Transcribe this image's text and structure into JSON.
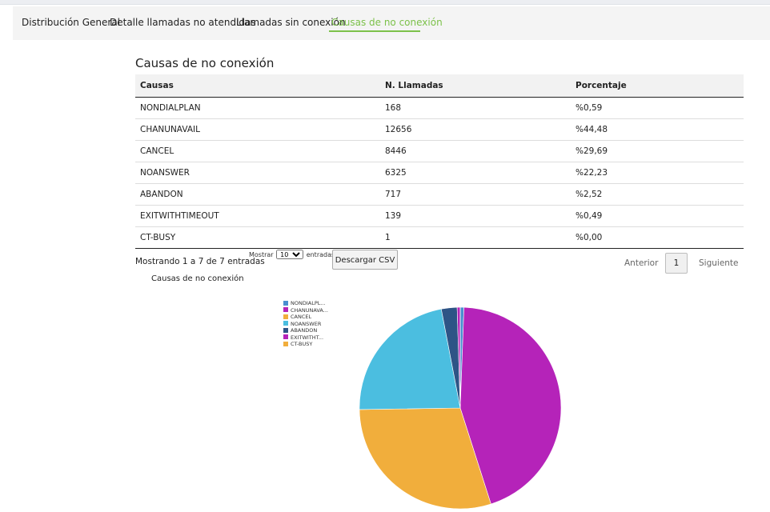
{
  "tabs": [
    {
      "label": "Distribución General"
    },
    {
      "label": "Detalle llamadas no atendidas"
    },
    {
      "label": "Llamadas sin conexión"
    },
    {
      "label": "Causas de no conexión"
    }
  ],
  "page_title": "Causas de no conexión",
  "table": {
    "headers": [
      "Causas",
      "N. Llamadas",
      "Porcentaje"
    ],
    "rows": [
      [
        "NONDIALPLAN",
        "168",
        "%0,59"
      ],
      [
        "CHANUNAVAIL",
        "12656",
        "%44,48"
      ],
      [
        "CANCEL",
        "8446",
        "%29,69"
      ],
      [
        "NOANSWER",
        "6325",
        "%22,23"
      ],
      [
        "ABANDON",
        "717",
        "%2,52"
      ],
      [
        "EXITWITHTIMEOUT",
        "139",
        "%0,49"
      ],
      [
        "CT-BUSY",
        "1",
        "%0,00"
      ]
    ]
  },
  "table_info": "Mostrando 1 a 7 de 7 entradas",
  "length_menu": {
    "prefix": "Mostrar",
    "selected": "10",
    "suffix": "entradas"
  },
  "csv_button": "Descargar CSV",
  "pagination": {
    "previous": "Anterior",
    "current": "1",
    "next": "Siguiente"
  },
  "chart_data": {
    "type": "pie",
    "title": "Causas de no conexión",
    "legend_position": "left",
    "legend_labels": [
      "NONDIALPL...",
      "CHANUNAVA...",
      "CANCEL",
      "NOANSWER",
      "ABANDON",
      "EXITWITHT...",
      "CT-BUSY"
    ],
    "categories": [
      "NONDIALPLAN",
      "CHANUNAVAIL",
      "CANCEL",
      "NOANSWER",
      "ABANDON",
      "EXITWITHTIMEOUT",
      "CT-BUSY"
    ],
    "values": [
      168,
      12656,
      8446,
      6325,
      717,
      139,
      1
    ],
    "colors": [
      "#4a8fd0",
      "#b523b9",
      "#f1ae3c",
      "#4bbee0",
      "#2e5486",
      "#b523b9",
      "#f1ae3c"
    ]
  }
}
